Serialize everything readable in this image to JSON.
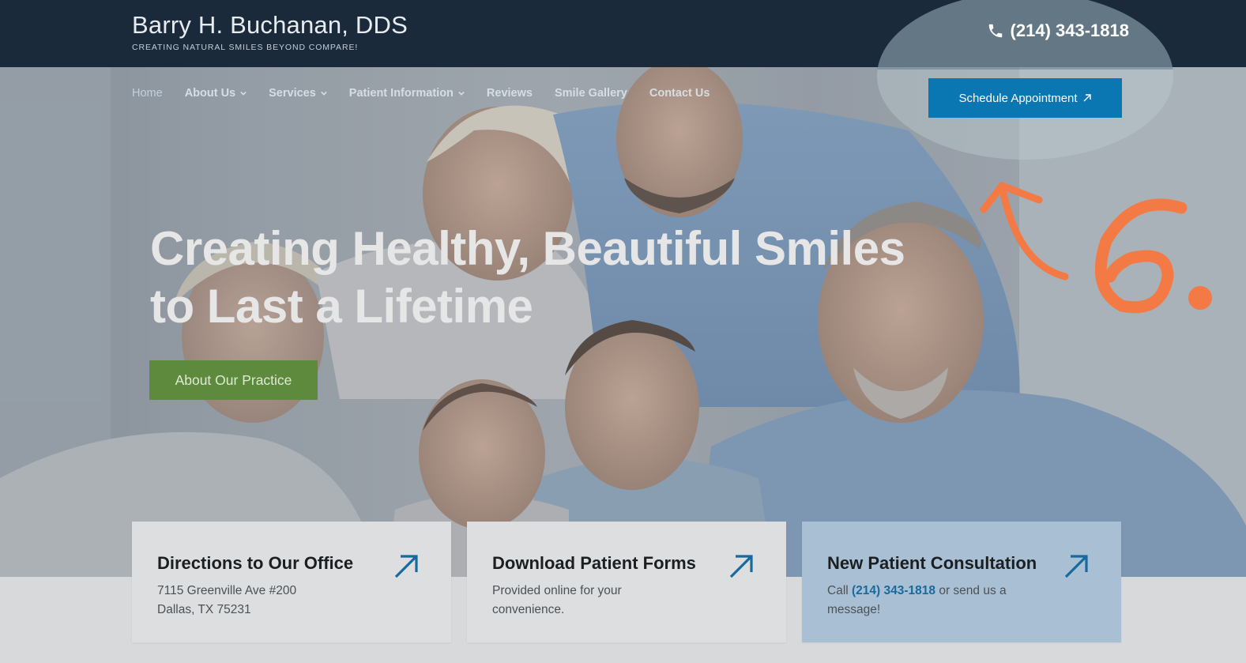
{
  "header": {
    "brand_name": "Barry H. Buchanan, DDS",
    "tagline": "CREATING NATURAL SMILES BEYOND COMPARE!",
    "phone": "(214) 343-1818"
  },
  "nav": {
    "items": [
      {
        "label": "Home",
        "active": true
      },
      {
        "label": "About Us",
        "dropdown": true
      },
      {
        "label": "Services",
        "dropdown": true
      },
      {
        "label": "Patient Information",
        "dropdown": true
      },
      {
        "label": "Reviews"
      },
      {
        "label": "Smile Gallery"
      },
      {
        "label": "Contact Us"
      }
    ],
    "cta_label": "Schedule Appointment",
    "cta_icon": "arrow-up-right-icon"
  },
  "hero": {
    "headline_line1": "Creating Healthy, Beautiful Smiles",
    "headline_line2": "to Last a Lifetime",
    "button_label": "About Our Practice"
  },
  "annotation": {
    "label": "6.",
    "color": "#f47a45"
  },
  "cards": [
    {
      "title": "Directions to Our Office",
      "line1": "7115 Greenville Ave #200",
      "line2": "Dallas, TX 75231",
      "icon": "arrow-up-right-icon"
    },
    {
      "title": "Download Patient Forms",
      "line1": "Provided online for your",
      "line2": "convenience.",
      "icon": "arrow-up-right-icon"
    },
    {
      "title": "New Patient Consultation",
      "text_pre": "Call ",
      "phone": "(214) 343-1818",
      "text_post": " or send us a",
      "line2": "message!",
      "icon": "arrow-up-right-icon"
    }
  ],
  "colors": {
    "header_bg": "#1b2a3b",
    "cta_bg": "#0a76b2",
    "practice_btn_bg": "#5e8a3d",
    "card_alt_bg": "#a9c0d4",
    "link": "#176a9e"
  }
}
